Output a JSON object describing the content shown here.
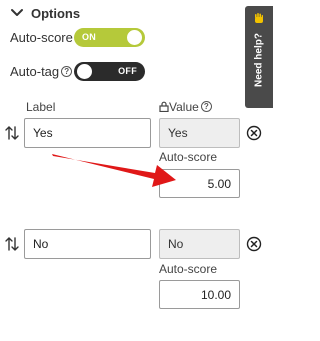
{
  "options": {
    "title": "Options"
  },
  "auto_score": {
    "label": "Auto-score",
    "toggle_text": "ON",
    "on": true
  },
  "auto_tag": {
    "label": "Auto-tag",
    "help": "?",
    "toggle_text": "OFF",
    "on": false
  },
  "columns": {
    "label": "Label",
    "value": "Value",
    "value_help": "?"
  },
  "rows": [
    {
      "label": "Yes",
      "value": "Yes",
      "auto_score_label": "Auto-score",
      "auto_score": "5.00"
    },
    {
      "label": "No",
      "value": "No",
      "auto_score_label": "Auto-score",
      "auto_score": "10.00"
    }
  ],
  "help_tab": {
    "label": "Need help?"
  },
  "colors": {
    "toggle_on": "#b5c93a",
    "toggle_off": "#2b2b2b",
    "arrow": "#e01818",
    "help_tab": "#4a4a4a"
  }
}
